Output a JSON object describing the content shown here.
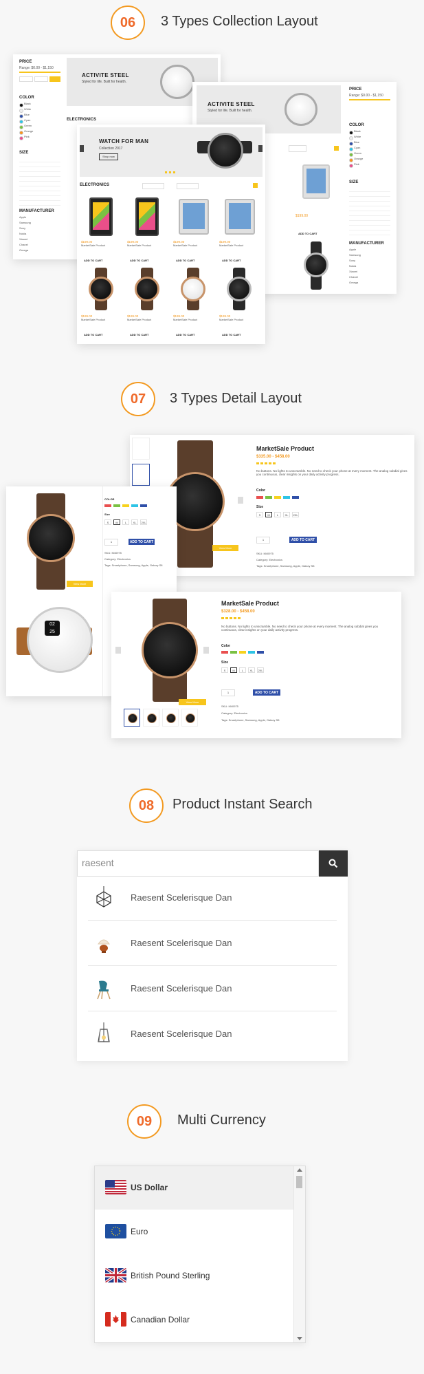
{
  "sections": [
    {
      "number": "06",
      "title": "3 Types Collection Layout"
    },
    {
      "number": "07",
      "title": "3 Types Detail Layout"
    },
    {
      "number": "08",
      "title": "Product Instant Search"
    },
    {
      "number": "09",
      "title": "Multi Currency"
    }
  ],
  "collection": {
    "back1": {
      "hero_title": "ACTIVITE STEEL",
      "hero_sub": "Styled for life. Built for health.",
      "heading": "ELECTRONICS",
      "price_label": "PRICE",
      "range": "Range: $0.00 - $1,150",
      "color_label": "COLOR",
      "size_label": "SIZE",
      "manufacturer_label": "MANUFACTURER"
    },
    "back2": {
      "hero_title": "ACTIVITE STEEL",
      "hero_sub": "Styled for life. Built for health.",
      "price_label": "PRICE",
      "range": "Range: $0.00 - $1,150",
      "color_label": "COLOR",
      "size_label": "SIZE",
      "manufacturer_label": "MANUFACTURER",
      "price": "$199.00",
      "add_to_cart": "ADD TO CART"
    },
    "front": {
      "hero_title": "WATCH FOR MAN",
      "hero_sub": "Collection 2017",
      "hero_button": "Shop now",
      "heading": "ELECTRONICS",
      "prices": [
        "$199.00",
        "$199.00",
        "$199.00",
        "$199.00",
        "$199.00",
        "$199.00",
        "$199.00",
        "$199.00"
      ],
      "names": [
        "MarketSale Product",
        "MarketSale Product",
        "MarketSale Product",
        "MarketSale Product",
        "MarketSale Product",
        "MarketSale Product",
        "MarketSale Product",
        "MarketSale Product"
      ],
      "add_to_cart": "ADD TO CART"
    },
    "colors": [
      "Black",
      "White",
      "Blue",
      "Cyan",
      "Green",
      "Orange",
      "Pink"
    ],
    "color_hex": [
      "#111111",
      "#eeeeee",
      "#2f4fa8",
      "#2ec4e6",
      "#7ac143",
      "#f7931e",
      "#e94f8a"
    ],
    "manufacturers": [
      "Apple",
      "Samsung",
      "Sony",
      "Nokia",
      "Xiaomi",
      "Chanel",
      "Omega"
    ]
  },
  "detail": {
    "top": {
      "title": "MarketSale Product",
      "price": "$335.00 - $458.00",
      "description": "No buttons. No lights to unscramble. No need to check your phone at every moment. The analog subdial gives you continuous, clear insights on your daily activity progress.",
      "color_label": "Color",
      "size_label": "Size",
      "sizes": [
        "S",
        "M",
        "L",
        "XL",
        "2XL"
      ],
      "qty": "1",
      "add_to_cart": "ADD TO CART",
      "sku": "SKU: M40975",
      "category": "Category: Electronics",
      "tags": "Tags: Smartphone, Samsung, Apple, Galaxy S8",
      "view_more": "View More"
    },
    "left": {
      "color_label": "COLOR",
      "size_label": "Size",
      "sizes": [
        "S",
        "M",
        "L",
        "XL",
        "2XL"
      ],
      "qty": "1",
      "add_to_cart": "ADD TO CART",
      "sku": "SKU: M40975",
      "category": "Category: Electronics",
      "tags": "Tags: Smartphone, Samsung, Apple, Galaxy S8",
      "view_more": "View More",
      "digital_time": "02",
      "digital_time2": "25"
    },
    "bottom": {
      "title": "MarketSale Product",
      "price": "$328.00 - $458.00",
      "description": "No buttons. No lights to unscramble. No need to check your phone at every moment. The analog subdial gives you continuous, clear insights on your daily activity progress.",
      "color_label": "Color",
      "size_label": "Size",
      "sizes": [
        "S",
        "M",
        "L",
        "XL",
        "2XL"
      ],
      "qty": "1",
      "add_to_cart": "ADD TO CART",
      "sku": "SKU: M40975",
      "category": "Category: Electronics",
      "tags": "Tags: Smartphone, Samsung, Apple, Galaxy S8",
      "view_more": "View More"
    },
    "swatch_colors": [
      "#e94f4f",
      "#7ac143",
      "#f7d21e",
      "#2ec4e6",
      "#2f4fa8"
    ]
  },
  "search": {
    "query": "raesent",
    "results": [
      {
        "icon": "geometric-lamp-icon",
        "text": "Raesent Scelerisque Dan"
      },
      {
        "icon": "table-lamp-icon",
        "text": "Raesent Scelerisque Dan"
      },
      {
        "icon": "chair-icon",
        "text": "Raesent Scelerisque Dan"
      },
      {
        "icon": "pendant-lamp-icon",
        "text": "Raesent Scelerisque Dan"
      }
    ]
  },
  "currency": {
    "items": [
      {
        "flag": "us-flag-icon",
        "label": "US Dollar",
        "active": true
      },
      {
        "flag": "eu-flag-icon",
        "label": "Euro",
        "active": false
      },
      {
        "flag": "uk-flag-icon",
        "label": "British Pound Sterling",
        "active": false
      },
      {
        "flag": "canada-flag-icon",
        "label": "Canadian Dollar",
        "active": false
      }
    ]
  },
  "colors": {
    "accent_orange": "#ef6a2a",
    "accent_yellow": "#f7c51c",
    "blue_button": "#2f4fa8",
    "price_orange": "#f39a21"
  }
}
